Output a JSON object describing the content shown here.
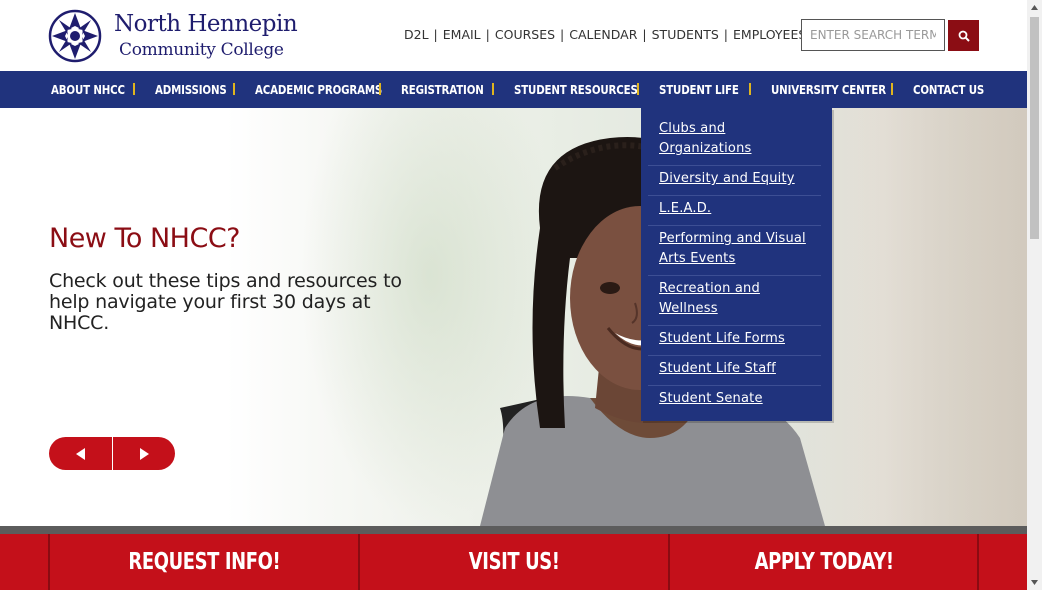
{
  "logo": {
    "line1": "North Hennepin",
    "line2": "Community College"
  },
  "utility_nav": [
    {
      "label": "D2L"
    },
    {
      "label": "EMAIL"
    },
    {
      "label": "COURSES"
    },
    {
      "label": "CALENDAR"
    },
    {
      "label": "STUDENTS"
    },
    {
      "label": "EMPLOYEES"
    }
  ],
  "search": {
    "placeholder": "ENTER SEARCH TERM",
    "icon": "search-icon"
  },
  "main_nav": [
    {
      "label": "ABOUT NHCC"
    },
    {
      "label": "ADMISSIONS"
    },
    {
      "label": "ACADEMIC PROGRAMS"
    },
    {
      "label": "REGISTRATION"
    },
    {
      "label": "STUDENT RESOURCES"
    },
    {
      "label": "STUDENT LIFE"
    },
    {
      "label": "UNIVERSITY CENTER"
    },
    {
      "label": "CONTACT US"
    }
  ],
  "dropdown": [
    {
      "label": "Clubs and Organizations"
    },
    {
      "label": "Diversity and Equity"
    },
    {
      "label": "L.E.A.D."
    },
    {
      "label": "Performing and Visual Arts Events"
    },
    {
      "label": "Recreation and Wellness"
    },
    {
      "label": "Student Life Forms"
    },
    {
      "label": "Student Life Staff"
    },
    {
      "label": "Student Senate"
    }
  ],
  "hero": {
    "heading": "New To NHCC?",
    "text": "Check out these tips and resources to help navigate your first 30 days at NHCC."
  },
  "cta": [
    {
      "label": "REQUEST INFO!"
    },
    {
      "label": "VISIT US!"
    },
    {
      "label": "APPLY TODAY!"
    }
  ],
  "colors": {
    "brand_blue": "#20337d",
    "brand_red": "#c4101a",
    "accent_gold": "#e0b51f",
    "heading_red": "#8b0d14"
  }
}
